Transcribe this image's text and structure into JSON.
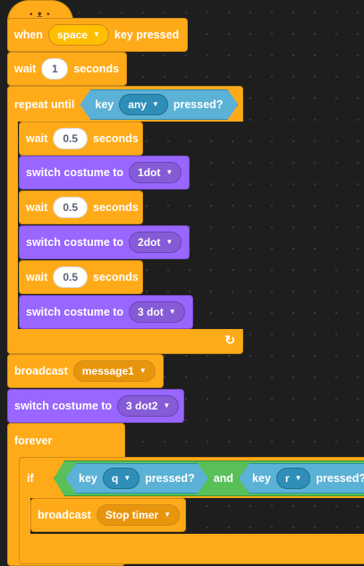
{
  "hat": {
    "when": "when",
    "key": "space",
    "suffix": "key pressed"
  },
  "wait1": {
    "label": "wait",
    "value": "1",
    "unit": "seconds"
  },
  "repeat": {
    "label": "repeat until",
    "sensing": {
      "key": "key",
      "option": "any",
      "suffix": "pressed?"
    }
  },
  "inner": [
    {
      "kind": "wait",
      "label": "wait",
      "value": "0.5",
      "unit": "seconds"
    },
    {
      "kind": "costume",
      "label": "switch costume to",
      "value": "1dot"
    },
    {
      "kind": "wait",
      "label": "wait",
      "value": "0.5",
      "unit": "seconds"
    },
    {
      "kind": "costume",
      "label": "switch costume to",
      "value": "2dot"
    },
    {
      "kind": "wait",
      "label": "wait",
      "value": "0.5",
      "unit": "seconds"
    },
    {
      "kind": "costume",
      "label": "switch costume to",
      "value": "3 dot"
    }
  ],
  "broadcast": {
    "label": "broadcast",
    "message": "message1"
  },
  "costume_after": {
    "label": "switch costume to",
    "value": "3 dot2"
  },
  "forever": {
    "label": "forever"
  },
  "if_block": {
    "label": "if",
    "cond_a": {
      "key": "key",
      "option": "q",
      "suffix": "pressed?"
    },
    "and": "and",
    "cond_b": {
      "key": "key",
      "option": "r",
      "suffix": "pressed?"
    }
  },
  "broadcast2": {
    "label": "broadcast",
    "message": "Stop timer"
  },
  "colors": {
    "events": "#ffab19",
    "looks": "#9966ff",
    "sensing": "#5cb1d6",
    "operators": "#59c059",
    "workspace": "#1e1e1e"
  }
}
